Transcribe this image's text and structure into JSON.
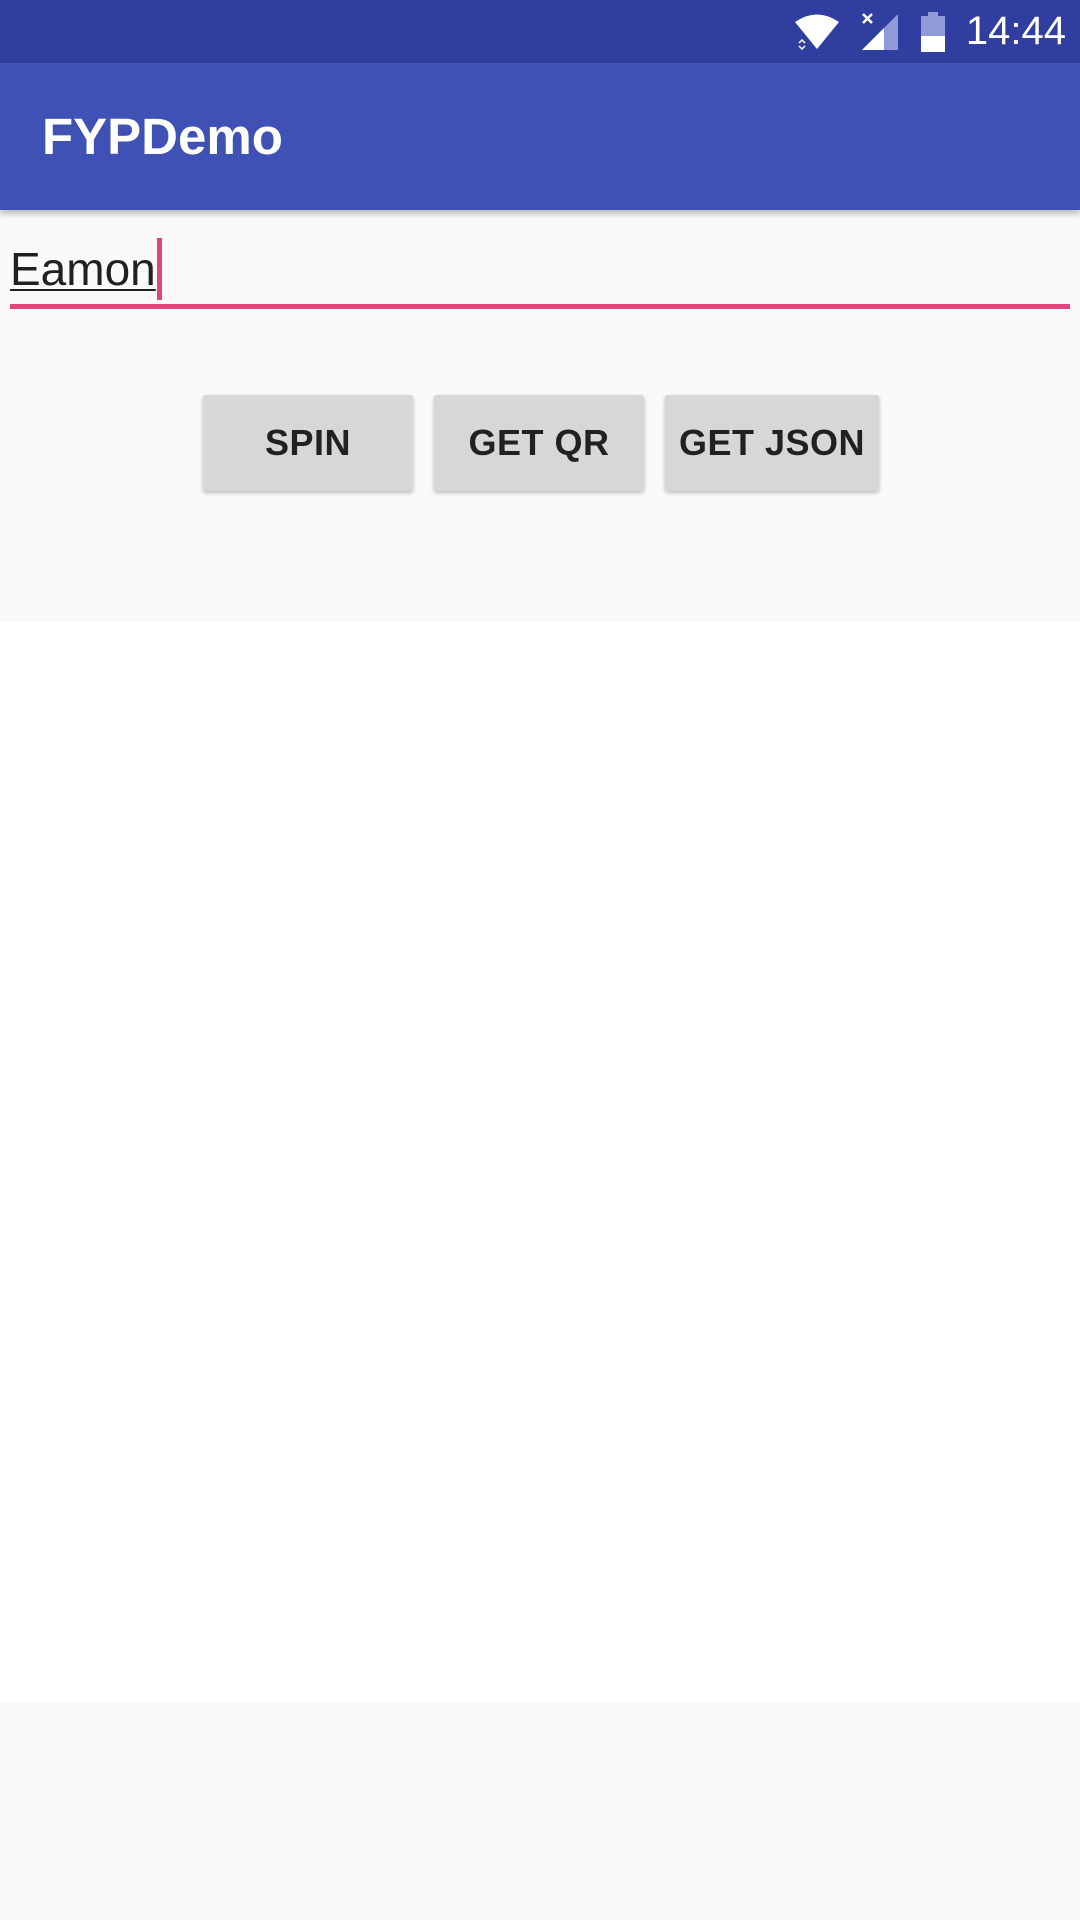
{
  "status_bar": {
    "time": "14:44",
    "icons": [
      "wifi-icon",
      "signal-icon",
      "battery-icon"
    ],
    "color": "#303f9f"
  },
  "app_bar": {
    "title": "FYPDemo",
    "color": "#3f51b5"
  },
  "form": {
    "name_value": "Eamon",
    "accent_color": "#e0457b"
  },
  "buttons": {
    "spin_label": "SPIN",
    "get_qr_label": "GET QR",
    "get_json_label": "GET JSON"
  }
}
